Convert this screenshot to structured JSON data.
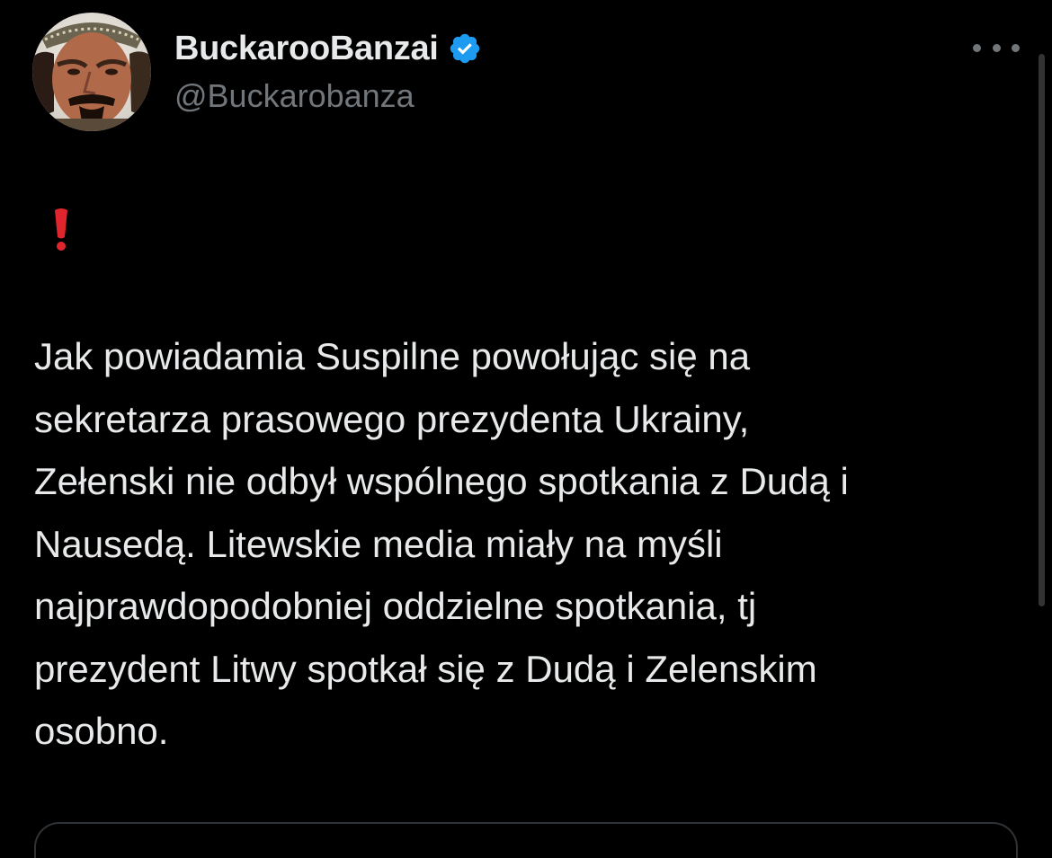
{
  "tweet": {
    "author": {
      "display_name": "BuckarooBanzai",
      "handle": "@Buckarobanza",
      "verified": true,
      "verified_color": "#1d9bf0",
      "avatar_icon": "profile-photo"
    },
    "emoji": "❗",
    "text_lines": [
      "Jak powiadamia Suspilne powołując się na",
      "sekretarza prasowego prezydenta Ukrainy,",
      "Zełenski nie odbył wspólnego spotkania z Dudą i",
      "Nausedą. Litewskie media miały na myśli",
      "najprawdopodobniej oddzielne spotkania, tj",
      "prezydent Litwy spotkał się z Dudą i Zelenskim",
      "osobno."
    ]
  },
  "colors": {
    "background": "#000000",
    "primary_text": "#e7e9ea",
    "secondary_text": "#71767b",
    "emoji_red": "#e0262c"
  },
  "icons": {
    "more": "more-horizontal-icon",
    "verified": "verified-badge-icon"
  }
}
